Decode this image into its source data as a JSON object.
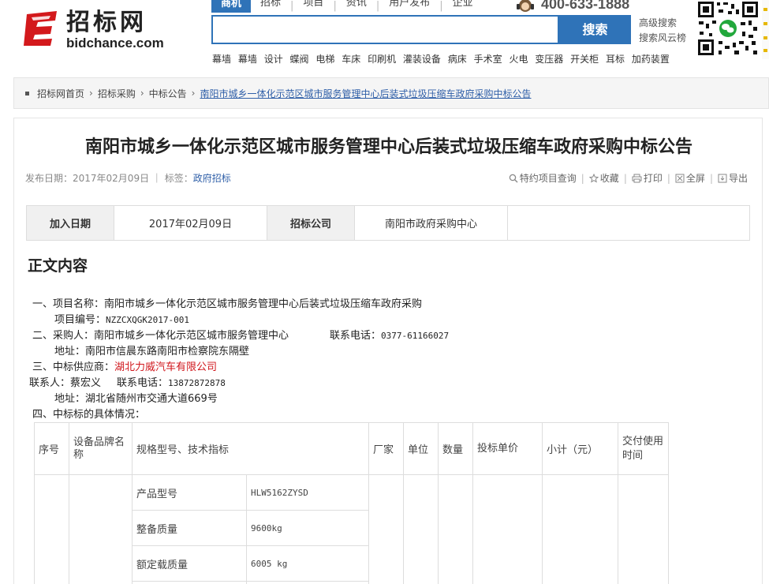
{
  "logo": {
    "cn": "招标网",
    "en": "bidchance.com"
  },
  "nav": {
    "items": [
      {
        "label": "商机",
        "active": true
      },
      {
        "label": "招标"
      },
      {
        "label": "项目"
      },
      {
        "label": "资讯"
      },
      {
        "label": "用户发布"
      },
      {
        "label": "企业"
      }
    ],
    "hotline": "400-633-1888"
  },
  "search": {
    "button": "搜索",
    "advanced": "高级搜索",
    "cloud": "搜索风云榜"
  },
  "hotwords": [
    "幕墙",
    "幕墙",
    "设计",
    "蝶阀",
    "电梯",
    "车床",
    "印刷机",
    "灌装设备",
    "病床",
    "手术室",
    "火电",
    "变压器",
    "开关柜",
    "耳标",
    "加药装置"
  ],
  "breadcrumb": {
    "items": [
      "招标网首页",
      "招标采购",
      "中标公告"
    ],
    "current": "南阳市城乡一体化示范区城市服务管理中心后装式垃圾压缩车政府采购中标公告"
  },
  "article": {
    "title": "南阳市城乡一体化示范区城市服务管理中心后装式垃圾压缩车政府采购中标公告",
    "meta_date": "发布日期：2017年02月09日",
    "meta_tag_label": "标签：",
    "meta_tag": "政府招标",
    "tools": [
      "特约项目查询",
      "收藏",
      "打印",
      "全屏",
      "导出"
    ]
  },
  "info": {
    "date_label": "加入日期",
    "date_value": "2017年02月09日",
    "company_label": "招标公司",
    "company_value": "南阳市政府采购中心"
  },
  "content": {
    "section_title": "正文内容",
    "l1": "一、项目名称：南阳市城乡一体化示范区城市服务管理中心后装式垃圾压缩车政府采购",
    "l2_label": "项目编号：",
    "l2_value": "NZZCXQGK2017-001",
    "l3_label": "二、采购人：南阳市城乡一体化示范区城市服务管理中心",
    "l3_tel_label": "联系电话：",
    "l3_tel": "0377-61166027",
    "l4": "地址：南阳市信晨东路南阳市检察院东隔壁",
    "l5_label": "三、中标供应商：",
    "l5_value": "湖北力威汽车有限公司",
    "l6_label": "联系人：蔡宏义",
    "l6_tel_label": "联系电话：",
    "l6_tel": "13872872878",
    "l7": "地址：湖北省随州市交通大道669号",
    "l8": "四、中标标的具体情况："
  },
  "spec": {
    "headers": {
      "no": "序号",
      "brand": "设备品牌名称",
      "model": "规格型号、技术指标",
      "maker": "厂家",
      "unit": "单位",
      "qty": "数量",
      "price": "投标单价",
      "subtotal": "小计（元）",
      "delivery": "交付使用时间"
    },
    "rows": [
      {
        "k": "产品型号",
        "v": "HLW5162ZYSD"
      },
      {
        "k": "整备质量",
        "v": "9600kg"
      },
      {
        "k": "额定载质量",
        "v": "6005 kg"
      }
    ]
  }
}
